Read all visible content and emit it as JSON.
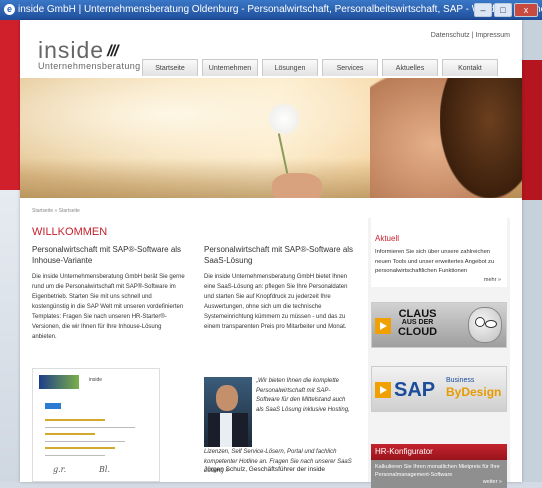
{
  "window": {
    "title": "inside GmbH | Unternehmensberatung Oldenburg - Personalwirtschaft, Personalbeitswirtschaft, SAP - Windows Internet Explorer",
    "icon": "ie-icon",
    "buttons": [
      "–",
      "□",
      "x"
    ]
  },
  "header": {
    "top_links": "Datenschutz | Impressum",
    "logo": {
      "main": "inside",
      "bars": "///",
      "sub": "Unternehmensberatung"
    },
    "nav": [
      "Startseite",
      "Unternehmen",
      "Lösungen",
      "Services",
      "Aktuelles",
      "Kontakt"
    ]
  },
  "breadcrumb": "Startseite » Startseite",
  "main": {
    "heading": "WILLKOMMEN",
    "col1": {
      "title": "Personalwirtschaft mit SAP®-Software als Inhouse-Variante",
      "body": "Die inside Unternehmensberatung GmbH berät Sie gerne rund um die Personalwirtschaft mit SAP®-Software im Eigenbetrieb. Starten Sie mit uns schnell und kostengünstig in die SAP Welt mit unseren vordefinierten Templates: Fragen Sie nach unseren HR-Starter®-Versionen, die wir Ihnen für Ihre Inhouse-Lösung anbieten."
    },
    "col2": {
      "title": "Personalwirtschaft mit SAP®-Software als SaaS-Lösung",
      "body": "Die inside Unternehmensberatung GmbH bietet Ihnen eine SaaS-Lösung an: pflegen Sie Ihre Personaldaten und starten Sie auf Knopfdruck zu jederzeit Ihre Auswertungen, ohne sich um die technische Systemeinrichtung kümmern zu müssen - und das zu einem transparenten Preis pro Mitarbeiter und Monat.",
      "quote": "„Wir bieten Ihnen die komplette Personalwirtschaft mit SAP-Software für den Mittelstand auch als SaaS Lösung inklusive Hosting,",
      "quote_cont": "Lizenzen, Self Service-Lösern, Portal und fachlich kompetenter Hotline an. Fragen Sie nach unserer SaaS Lösung »",
      "author": "Jürgen Schulz, Geschäftsführer der inside"
    },
    "doc": {
      "header_text": "inside"
    }
  },
  "sidebar": {
    "aktuell": {
      "title": "Aktuell",
      "text": "Informieren Sie sich über unsere zahlreichen neuen Tools und unser erweitertes Angebot zu personalwirtschaftlichen Funktionen",
      "more": "mehr »"
    },
    "claus_banner": {
      "line1": "CLAUS",
      "line2": "AUS DER",
      "line3": "CLOUD"
    },
    "sap_banner": {
      "sap": "SAP",
      "business": "Business",
      "bydesign": "ByDesign"
    },
    "hr": {
      "title": "HR-Konfigurator",
      "text": "Kalkulieren Sie Ihren monatlichen Mietpreis für Ihre Personalmanagement-Software",
      "more": "weiter »"
    }
  },
  "colors": {
    "accent": "#c8202c",
    "sap_blue": "#1b4c9a",
    "bydesign_orange": "#e89a00"
  }
}
